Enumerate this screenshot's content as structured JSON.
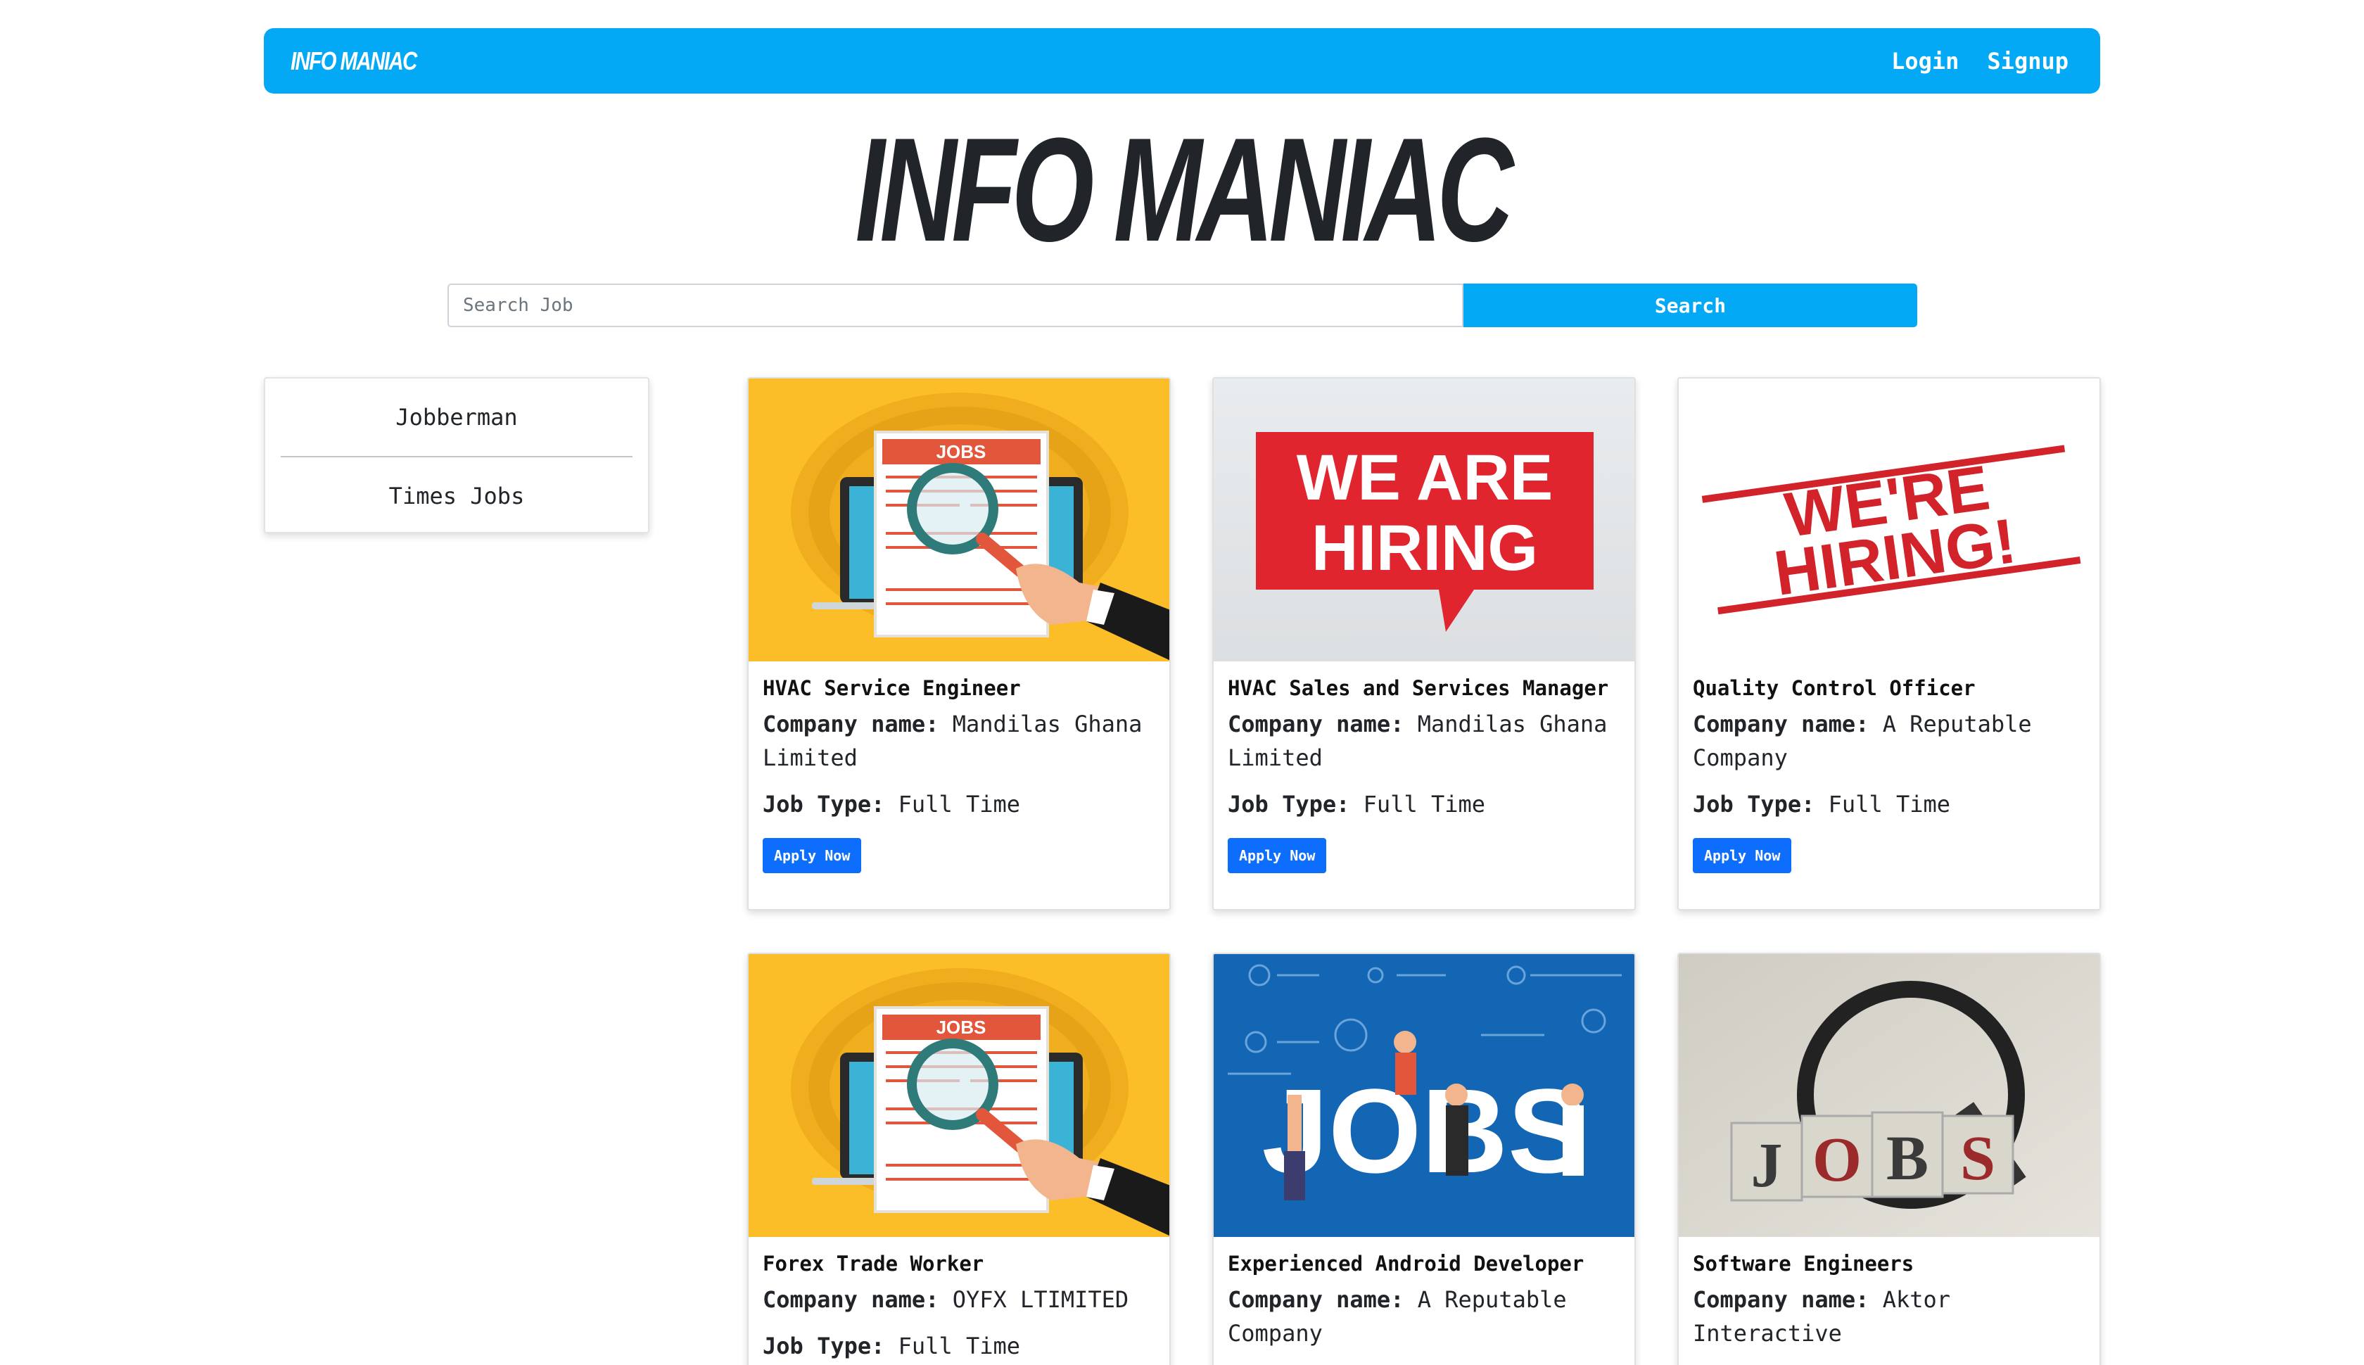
{
  "navbar": {
    "brand": "INFO MANIAC",
    "login": "Login",
    "signup": "Signup"
  },
  "hero": {
    "title": "INFO MANIAC"
  },
  "search": {
    "placeholder": "Search Job",
    "button": "Search"
  },
  "sidebar": {
    "items": [
      {
        "label": "Jobberman"
      },
      {
        "label": "Times Jobs"
      }
    ]
  },
  "labels": {
    "company": "Company name:",
    "job_type": "Job Type:",
    "apply": "Apply Now"
  },
  "images": {
    "hiring1": {
      "line1": "WE ARE",
      "line2": "HIRING"
    },
    "hiring2": {
      "line1": "WE'RE",
      "line2": "HIRING!"
    },
    "jobs": "JOBS",
    "blocks": [
      "J",
      "O",
      "B",
      "S"
    ]
  },
  "cards": [
    {
      "title": "HVAC Service Engineer",
      "company": "Mandilas Ghana Limited",
      "job_type": "Full Time"
    },
    {
      "title": "HVAC Sales and Services Manager",
      "company": "Mandilas Ghana Limited",
      "job_type": "Full Time"
    },
    {
      "title": "Quality Control Officer",
      "company": "A Reputable Company",
      "job_type": "Full Time"
    },
    {
      "title": "Forex Trade Worker",
      "company": "OYFX LTIMITED",
      "job_type": "Full Time"
    },
    {
      "title": "Experienced Android Developer",
      "company": "A Reputable Company"
    },
    {
      "title": "Software Engineers",
      "company": "Aktor Interactive"
    }
  ],
  "colors": {
    "accent": "#03a9f4",
    "button": "#0d6efd"
  }
}
